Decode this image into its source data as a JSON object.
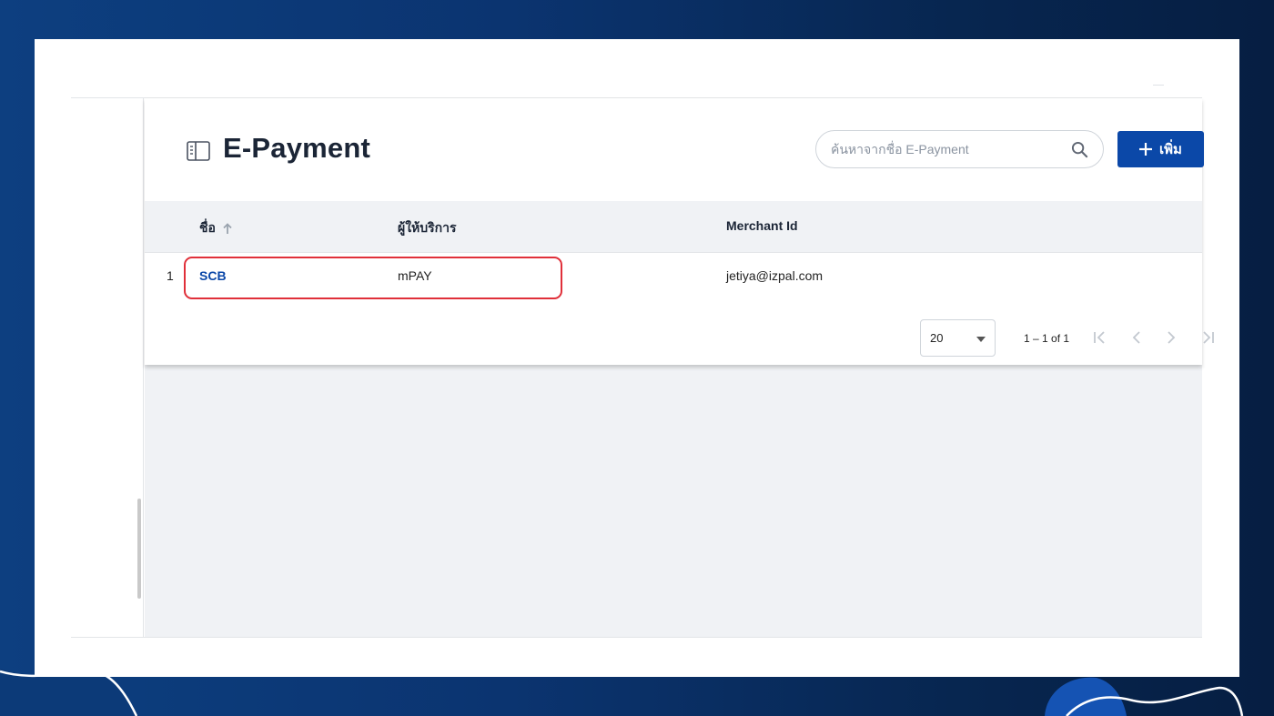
{
  "page": {
    "title": "E-Payment",
    "search": {
      "placeholder": "ค้นหาจากชื่อ E-Payment",
      "value": ""
    },
    "add_button_label": "เพิ่ม"
  },
  "table": {
    "columns": [
      {
        "label": "ชื่อ",
        "sort": "ascending"
      },
      {
        "label": "ผู้ให้บริการ"
      },
      {
        "label": "Merchant Id"
      }
    ],
    "rows": [
      {
        "index": "1",
        "name": "SCB",
        "provider": "mPAY",
        "merchant_id": "jetiya@izpal.com"
      }
    ]
  },
  "pagination": {
    "page_size": "20",
    "range_label": "1 – 1 of 1"
  },
  "colors": {
    "primary": "#0b48a8",
    "highlight": "#e0303a",
    "background_navy": "#0b3470",
    "table_header_bg": "#f0f2f5"
  },
  "icons": [
    "page-layout-icon",
    "search-icon",
    "plus-icon",
    "sort-arrow-up-icon",
    "caret-down-icon",
    "first-page-icon",
    "prev-page-icon",
    "next-page-icon",
    "last-page-icon"
  ]
}
